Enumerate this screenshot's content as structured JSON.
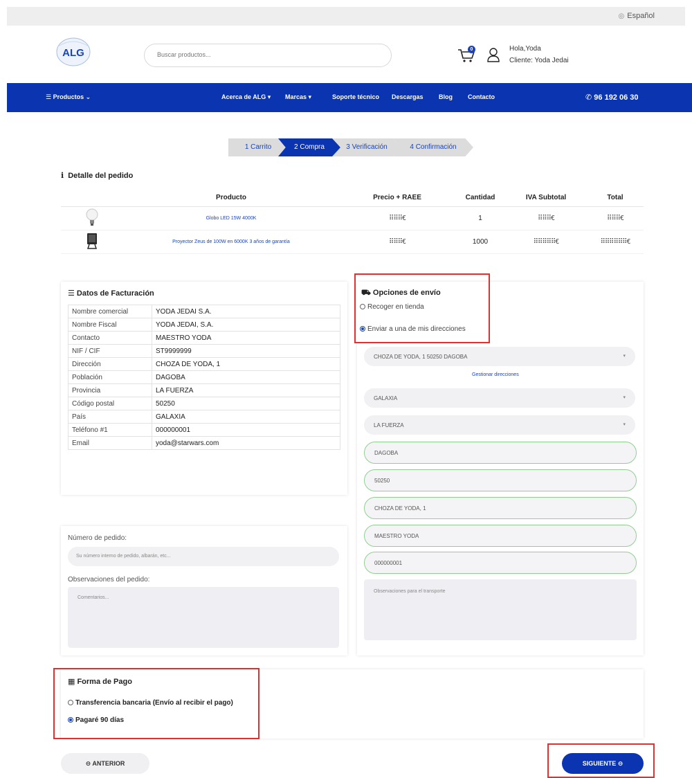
{
  "topbar": {
    "language": "Español"
  },
  "header": {
    "logo_text": "ALG",
    "search_placeholder": "Buscar productos...",
    "cart_count": "0",
    "greeting": "Hola,Yoda",
    "client": "Cliente: Yoda Jedai"
  },
  "nav": {
    "items": [
      "Productos",
      "Acerca de ALG",
      "Marcas",
      "Soporte técnico",
      "Descargas",
      "Blog",
      "Contacto"
    ],
    "phone": "96 192 06 30"
  },
  "steps": [
    "1 Carrito",
    "2 Compra",
    "3 Verificación",
    "4 Confirmación"
  ],
  "order": {
    "title": "Detalle del pedido",
    "columns": [
      "Producto",
      "Precio + RAEE",
      "Cantidad",
      "IVA Subtotal",
      "Total"
    ],
    "rows": [
      {
        "product": "Globo LED 15W 4000K",
        "price": "⠿⠿⠿€",
        "qty": "1",
        "iva": "⠿⠿⠿€",
        "total": "⠿⠿⠿€"
      },
      {
        "product": "Proyector Zeus de 100W en 6000K 3 años de garantía",
        "price": "⠿⠿⠿€",
        "qty": "1000",
        "iva": "⠿⠿⠿⠿⠿€",
        "total": "⠿⠿⠿⠿⠿⠿€"
      }
    ]
  },
  "billing": {
    "title": "Datos de Facturación",
    "rows": [
      {
        "k": "Nombre comercial",
        "v": "YODA JEDAI S.A."
      },
      {
        "k": "Nombre Fiscal",
        "v": "YODA JEDAI, S.A."
      },
      {
        "k": "Contacto",
        "v": "MAESTRO YODA"
      },
      {
        "k": "NIF / CIF",
        "v": "ST9999999"
      },
      {
        "k": "Dirección",
        "v": "CHOZA DE YODA, 1"
      },
      {
        "k": "Población",
        "v": "DAGOBA"
      },
      {
        "k": "Provincia",
        "v": "LA FUERZA"
      },
      {
        "k": "Código postal",
        "v": "50250"
      },
      {
        "k": "País",
        "v": "GALAXIA"
      },
      {
        "k": "Teléfono #1",
        "v": "000000001"
      },
      {
        "k": "Email",
        "v": "yoda@starwars.com"
      }
    ]
  },
  "shipping": {
    "title": "Opciones de envío",
    "option_pickup": "Recoger en tienda",
    "option_ship": "Enviar a una de mis direcciones",
    "selected": "ship",
    "address_select": "CHOZA DE YODA, 1 50250 DAGOBA",
    "manage_link": "Gestionar direcciones",
    "country": "GALAXIA",
    "province": "LA FUERZA",
    "city": "DAGOBA",
    "postal_code": "50250",
    "address": "CHOZA DE YODA, 1",
    "contact": "MAESTRO YODA",
    "phone": "000000001",
    "notes_placeholder": "Observaciones para el transporte"
  },
  "order_extra": {
    "number_label": "Número de pedido:",
    "number_placeholder": "Su número interno de pedido, albarán, etc...",
    "notes_label": "Observaciones del pedido:",
    "notes_placeholder": "Comentarios..."
  },
  "payment": {
    "title": "Forma de Pago",
    "option_transfer": "Transferencia bancaria (Envío al recibir el pago)",
    "option_pagare": "Pagaré 90 días",
    "selected": "pagare"
  },
  "buttons": {
    "prev": "ANTERIOR",
    "next": "SIGUIENTE"
  },
  "colors": {
    "brand_blue": "#0b34b0",
    "highlight_red": "#e03030",
    "field_green": "#8fd08f"
  }
}
